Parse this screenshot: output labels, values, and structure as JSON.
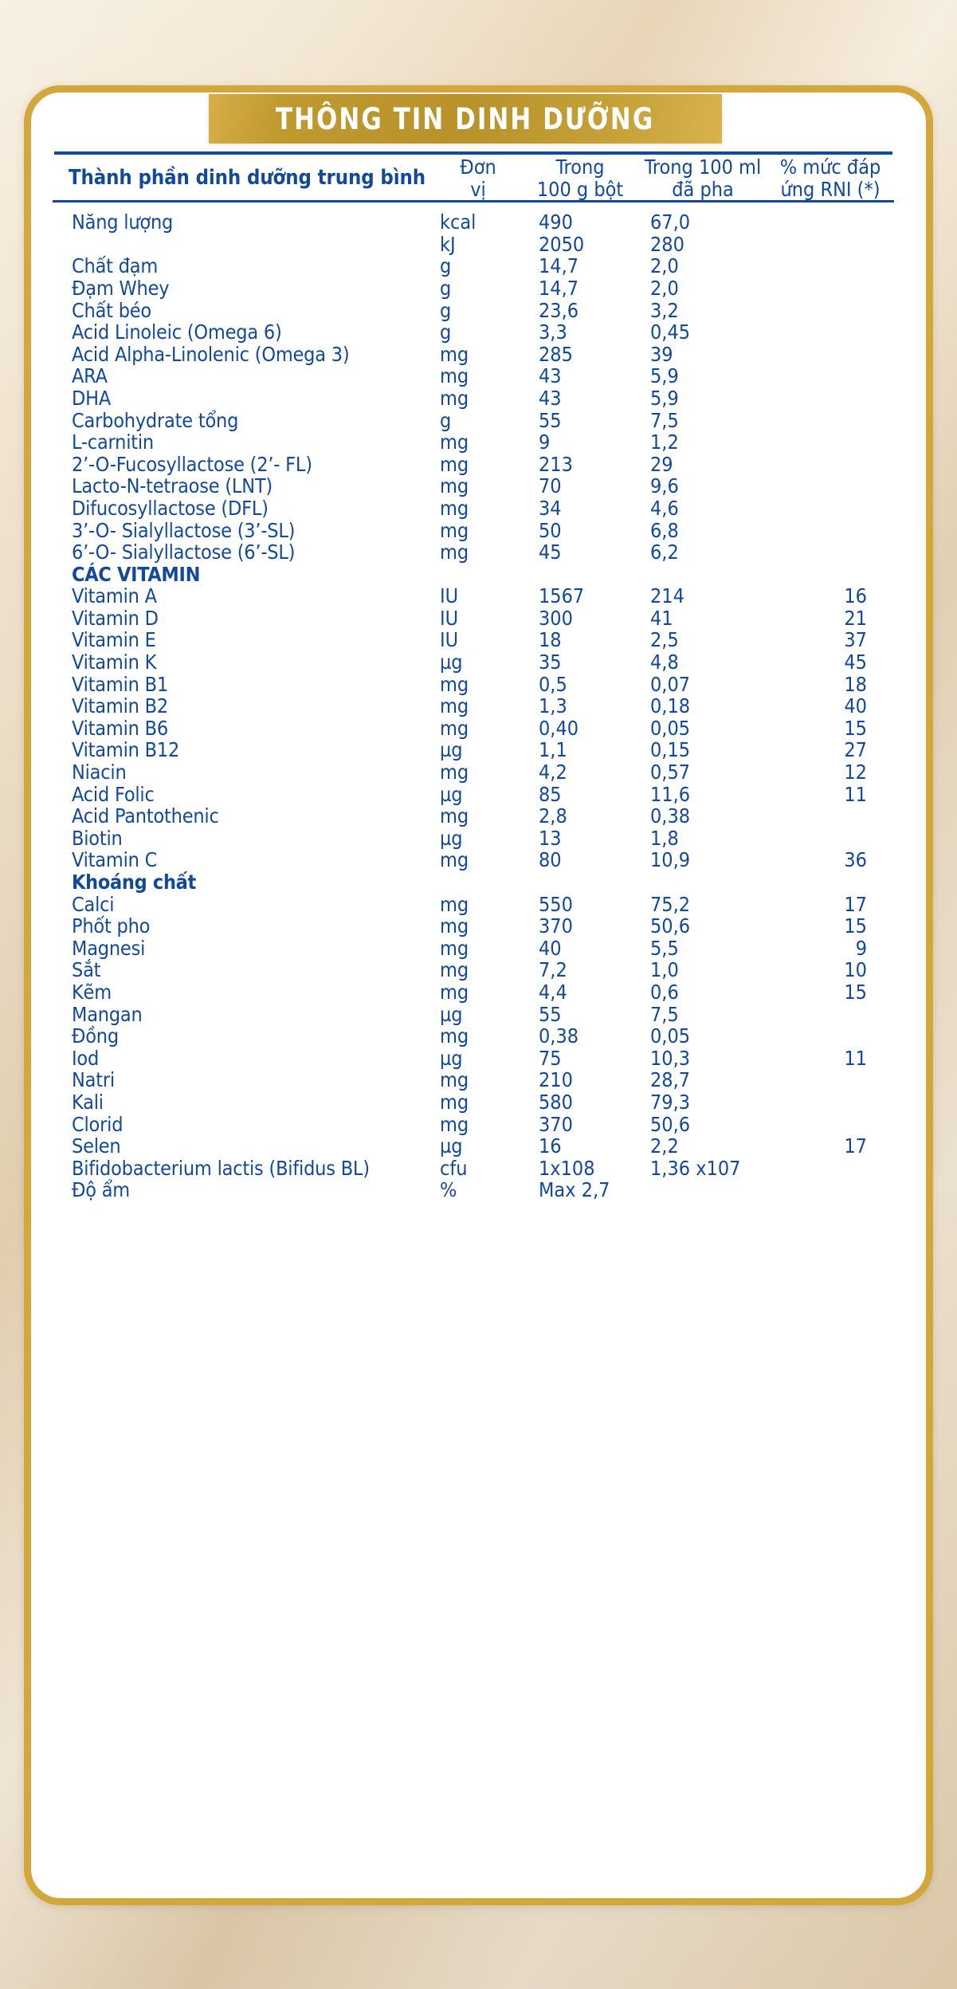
{
  "banner": {
    "title": "THÔNG TIN DINH DƯỠNG"
  },
  "table": {
    "headers": {
      "name": "Thành phần dinh dưỡng trung bình",
      "unit_line1": "Đơn",
      "unit_line2": "vị",
      "per100g_line1": "Trong",
      "per100g_line2": "100 g bột",
      "per100ml_line1": "Trong 100 ml",
      "per100ml_line2": "đã pha",
      "rni_line1": "% mức đáp",
      "rni_line2": "ứng RNI (*)"
    },
    "rows": [
      {
        "type": "item",
        "name": "Năng lượng",
        "unit": "kcal",
        "per100g": "490",
        "per100ml": "67,0",
        "rni": ""
      },
      {
        "type": "item",
        "name": "",
        "unit": "kJ",
        "per100g": "2050",
        "per100ml": "280",
        "rni": ""
      },
      {
        "type": "item",
        "name": "Chất đạm",
        "unit": "g",
        "per100g": "14,7",
        "per100ml": "2,0",
        "rni": ""
      },
      {
        "type": "item",
        "name": "Đạm Whey",
        "unit": "g",
        "per100g": "14,7",
        "per100ml": "2,0",
        "rni": ""
      },
      {
        "type": "item",
        "name": "Chất béo",
        "unit": "g",
        "per100g": "23,6",
        "per100ml": "3,2",
        "rni": ""
      },
      {
        "type": "item",
        "name": "Acid Linoleic (Omega 6)",
        "unit": "g",
        "per100g": "3,3",
        "per100ml": "0,45",
        "rni": ""
      },
      {
        "type": "item",
        "name": "Acid  Alpha-Linolenic (Omega 3)",
        "unit": "mg",
        "per100g": "285",
        "per100ml": "39",
        "rni": ""
      },
      {
        "type": "item",
        "name": "ARA",
        "unit": "mg",
        "per100g": "43",
        "per100ml": "5,9",
        "rni": ""
      },
      {
        "type": "item",
        "name": "DHA",
        "unit": "mg",
        "per100g": "43",
        "per100ml": "5,9",
        "rni": ""
      },
      {
        "type": "item",
        "name": "Carbohydrate tổng",
        "unit": "g",
        "per100g": "55",
        "per100ml": "7,5",
        "rni": ""
      },
      {
        "type": "item",
        "name": "L-carnitin",
        "unit": "mg",
        "per100g": "9",
        "per100ml": "1,2",
        "rni": ""
      },
      {
        "type": "item",
        "name": "2’-O-Fucosyllactose (2’- FL)",
        "unit": "mg",
        "per100g": "213",
        "per100ml": "29",
        "rni": ""
      },
      {
        "type": "item",
        "name": "Lacto-N-tetraose (LNT)",
        "unit": "mg",
        "per100g": "70",
        "per100ml": "9,6",
        "rni": ""
      },
      {
        "type": "item",
        "name": "Difucosyllactose (DFL)",
        "unit": "mg",
        "per100g": "34",
        "per100ml": "4,6",
        "rni": ""
      },
      {
        "type": "item",
        "name": "3’-O- Sialyllactose (3’-SL)",
        "unit": "mg",
        "per100g": "50",
        "per100ml": "6,8",
        "rni": ""
      },
      {
        "type": "item",
        "name": "6’-O- Sialyllactose (6’-SL)",
        "unit": "mg",
        "per100g": "45",
        "per100ml": "6,2",
        "rni": ""
      },
      {
        "type": "section",
        "name": "CÁC VITAMIN",
        "unit": "",
        "per100g": "",
        "per100ml": "",
        "rni": ""
      },
      {
        "type": "item",
        "name": "Vitamin A",
        "unit": "IU",
        "per100g": "1567",
        "per100ml": "214",
        "rni": "16"
      },
      {
        "type": "item",
        "name": "Vitamin D",
        "unit": "IU",
        "per100g": "300",
        "per100ml": "41",
        "rni": "21"
      },
      {
        "type": "item",
        "name": "Vitamin E",
        "unit": "IU",
        "per100g": "18",
        "per100ml": "2,5",
        "rni": "37"
      },
      {
        "type": "item",
        "name": "Vitamin K",
        "unit": "µg",
        "per100g": "35",
        "per100ml": "4,8",
        "rni": "45"
      },
      {
        "type": "item",
        "name": "Vitamin B1",
        "unit": "mg",
        "per100g": "0,5",
        "per100ml": "0,07",
        "rni": "18"
      },
      {
        "type": "item",
        "name": "Vitamin B2",
        "unit": "mg",
        "per100g": "1,3",
        "per100ml": "0,18",
        "rni": "40"
      },
      {
        "type": "item",
        "name": "Vitamin B6",
        "unit": "mg",
        "per100g": "0,40",
        "per100ml": "0,05",
        "rni": "15"
      },
      {
        "type": "item",
        "name": "Vitamin B12",
        "unit": "µg",
        "per100g": "1,1",
        "per100ml": "0,15",
        "rni": "27"
      },
      {
        "type": "item",
        "name": "Niacin",
        "unit": "mg",
        "per100g": "4,2",
        "per100ml": "0,57",
        "rni": "12"
      },
      {
        "type": "item",
        "name": "Acid Folic",
        "unit": "µg",
        "per100g": "85",
        "per100ml": "11,6",
        "rni": "11"
      },
      {
        "type": "item",
        "name": "Acid Pantothenic",
        "unit": "mg",
        "per100g": "2,8",
        "per100ml": "0,38",
        "rni": ""
      },
      {
        "type": "item",
        "name": "Biotin",
        "unit": "µg",
        "per100g": "13",
        "per100ml": "1,8",
        "rni": ""
      },
      {
        "type": "item",
        "name": "Vitamin C",
        "unit": "mg",
        "per100g": "80",
        "per100ml": "10,9",
        "rni": "36"
      },
      {
        "type": "section",
        "name": "Khoáng chất",
        "unit": "",
        "per100g": "",
        "per100ml": "",
        "rni": ""
      },
      {
        "type": "item",
        "name": "Calci",
        "unit": "mg",
        "per100g": "550",
        "per100ml": "75,2",
        "rni": "17"
      },
      {
        "type": "item",
        "name": "Phốt pho",
        "unit": "mg",
        "per100g": "370",
        "per100ml": "50,6",
        "rni": "15"
      },
      {
        "type": "item",
        "name": "Magnesi",
        "unit": "mg",
        "per100g": "40",
        "per100ml": "5,5",
        "rni": "9"
      },
      {
        "type": "item",
        "name": "Sắt",
        "unit": "mg",
        "per100g": "7,2",
        "per100ml": "1,0",
        "rni": "10"
      },
      {
        "type": "item",
        "name": "Kẽm",
        "unit": "mg",
        "per100g": "4,4",
        "per100ml": "0,6",
        "rni": "15"
      },
      {
        "type": "item",
        "name": "Mangan",
        "unit": "µg",
        "per100g": "55",
        "per100ml": "7,5",
        "rni": ""
      },
      {
        "type": "item",
        "name": "Đồng",
        "unit": "mg",
        "per100g": "0,38",
        "per100ml": "0,05",
        "rni": ""
      },
      {
        "type": "item",
        "name": "Iod",
        "unit": "µg",
        "per100g": "75",
        "per100ml": "10,3",
        "rni": "11"
      },
      {
        "type": "item",
        "name": "Natri",
        "unit": "mg",
        "per100g": "210",
        "per100ml": "28,7",
        "rni": ""
      },
      {
        "type": "item",
        "name": "Kali",
        "unit": "mg",
        "per100g": "580",
        "per100ml": "79,3",
        "rni": ""
      },
      {
        "type": "item",
        "name": "Clorid",
        "unit": "mg",
        "per100g": "370",
        "per100ml": "50,6",
        "rni": ""
      },
      {
        "type": "item",
        "name": "Selen",
        "unit": "µg",
        "per100g": "16",
        "per100ml": "2,2",
        "rni": "17"
      },
      {
        "type": "item",
        "name": "Bifidobacterium lactis (Bifidus BL)",
        "unit": "cfu",
        "per100g": "1x108",
        "per100ml": "1,36 x107",
        "rni": ""
      },
      {
        "type": "item",
        "name": "Độ ẩm",
        "unit": "%",
        "per100g": "Max 2,7",
        "per100ml": "",
        "rni": ""
      }
    ]
  },
  "colors": {
    "brand_blue": "#13499b",
    "gold": "#c09a2f",
    "gold_border": "#d2a73c",
    "panel_bg": "#ffffff"
  }
}
